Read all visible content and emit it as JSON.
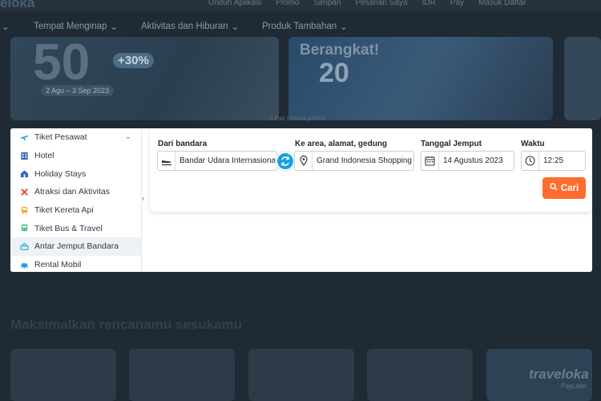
{
  "header": {
    "logo": "eloka",
    "top_links": [
      "Unduh Aplikasi",
      "Promo",
      "Simpan",
      "Pesanan Saya",
      "IDR",
      "Pay",
      "Masuk Daftar"
    ],
    "categories": [
      "Tempat Menginap",
      "Aktivitas dan Hiburan",
      "Produk Tambahan"
    ]
  },
  "banners": {
    "promo1_big": "50",
    "promo1_extra": "+30%",
    "promo1_dates": "2 Agu – 3 Sep 2023",
    "promo2_title": "Berangkat!",
    "promo2_big": "20",
    "see_all": "Lihat semua promo"
  },
  "sidebar": {
    "items": [
      {
        "label": "Tiket Pesawat",
        "icon": "airplane-icon"
      },
      {
        "label": "Hotel",
        "icon": "hotel-icon"
      },
      {
        "label": "Holiday Stays",
        "icon": "holiday-stays-icon"
      },
      {
        "label": "Atraksi dan Aktivitas",
        "icon": "attraction-icon"
      },
      {
        "label": "Tiket Kereta Api",
        "icon": "train-icon"
      },
      {
        "label": "Tiket Bus & Travel",
        "icon": "bus-icon"
      },
      {
        "label": "Antar Jemput Bandara",
        "icon": "airport-transfer-icon"
      },
      {
        "label": "Rental Mobil",
        "icon": "car-icon"
      }
    ],
    "active_index": 6
  },
  "form": {
    "from_label": "Dari bandara",
    "from_value": "Bandar Udara Internasional",
    "to_label": "Ke area, alamat, gedung",
    "to_value": "Grand Indonesia Shopping",
    "date_label": "Tanggal Jemput",
    "date_value": "14 Agustus 2023",
    "time_label": "Waktu",
    "time_value": "12:25",
    "search_label": "Cari"
  },
  "section": {
    "title": "Maksimalkan rencanamu sesukamu",
    "brand_card": "traveloka",
    "brand_card_sub": "PayLater"
  },
  "colors": {
    "accent_orange": "#ff6d2e",
    "swap_blue": "#1ba0e2",
    "backdrop": "#1f2a35"
  }
}
